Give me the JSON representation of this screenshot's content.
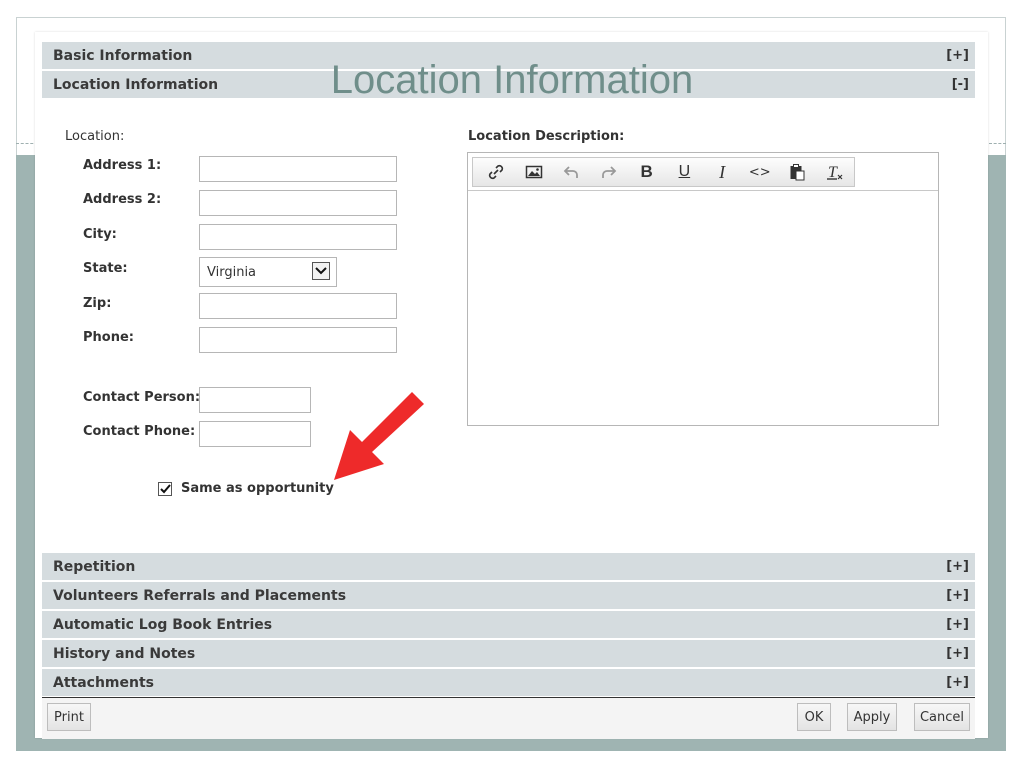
{
  "slide": {
    "title": "Location Information",
    "accent_color": "#9fb4b2",
    "title_color": "#6f8e8a"
  },
  "sections_top": [
    {
      "label": "Basic Information",
      "toggle": "[+]"
    },
    {
      "label": "Location Information",
      "toggle": "[-]"
    }
  ],
  "location": {
    "heading": "Location:",
    "address1_label": "Address 1:",
    "address2_label": "Address 2:",
    "city_label": "City:",
    "state_label": "State:",
    "state_value": "Virginia",
    "zip_label": "Zip:",
    "phone_label": "Phone:",
    "contact_person_label": "Contact Person:",
    "contact_phone_label": "Contact Phone:",
    "same_as_label": "Same as opportunity",
    "same_as_checked": true
  },
  "description": {
    "label": "Location Description:",
    "toolbar": [
      "link-icon",
      "image-icon",
      "undo-icon",
      "redo-icon",
      "bold-icon",
      "underline-icon",
      "italic-icon",
      "source-code-icon",
      "paste-icon",
      "clear-format-icon"
    ]
  },
  "sections_bottom": [
    {
      "label": "Repetition",
      "toggle": "[+]"
    },
    {
      "label": "Volunteers Referrals and Placements",
      "toggle": "[+]"
    },
    {
      "label": "Automatic Log Book Entries",
      "toggle": "[+]"
    },
    {
      "label": "History and Notes",
      "toggle": "[+]"
    },
    {
      "label": "Attachments",
      "toggle": "[+]"
    }
  ],
  "footer": {
    "print": "Print",
    "ok": "OK",
    "apply": "Apply",
    "cancel": "Cancel"
  },
  "annotation": {
    "arrow_color": "#ee2a2a"
  }
}
